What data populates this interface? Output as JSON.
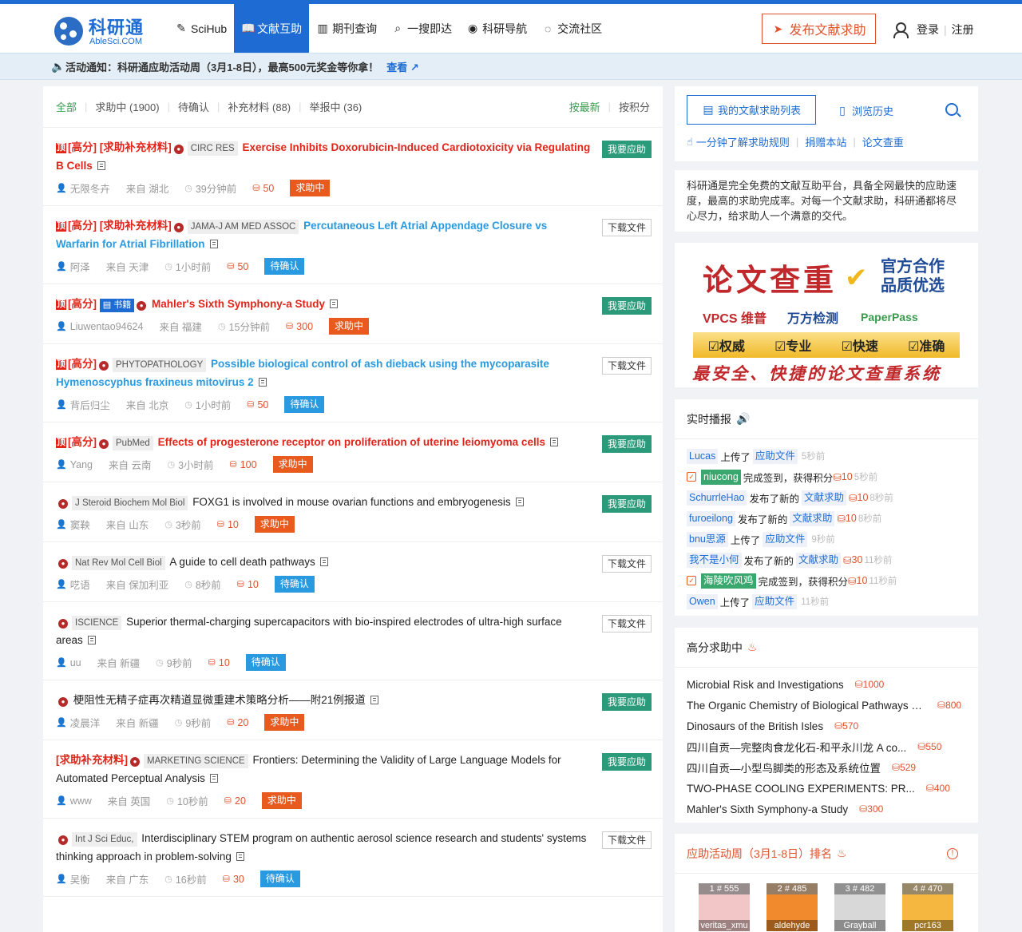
{
  "brand": {
    "name_cn": "科研通",
    "name_en": "AbleSci.COM"
  },
  "nav": [
    {
      "label": "SciHub",
      "icon": "feather-icon",
      "glyph": "✎"
    },
    {
      "label": "文献互助",
      "icon": "book-icon",
      "glyph": "📖",
      "active": true
    },
    {
      "label": "期刊查询",
      "icon": "journal-icon",
      "glyph": "▥"
    },
    {
      "label": "一搜即达",
      "icon": "search-icon",
      "glyph": "⌕"
    },
    {
      "label": "科研导航",
      "icon": "compass-icon",
      "glyph": "◉"
    },
    {
      "label": "交流社区",
      "icon": "chat-icon",
      "glyph": "◌"
    }
  ],
  "publish_label": "发布文献求助",
  "login_label": "登录",
  "register_label": "注册",
  "notice": {
    "text": "活动通知：科研通应助活动周（3月1-8日），最高500元奖金等你拿！",
    "link": "查看"
  },
  "filters": {
    "tabs": [
      "全部",
      "求助中 (1900)",
      "待确认",
      "补充材料 (88)",
      "举报中 (36)"
    ],
    "sort": [
      "按最新",
      "按积分"
    ]
  },
  "posts": [
    {
      "pin": true,
      "tags": "[高分] [求助补充材料]",
      "journal": "CIRC RES",
      "title": "Exercise Inhibits Doxorubicin-Induced Cardiotoxicity via Regulating B Cells",
      "title_color": "red",
      "user": "无限冬卉",
      "from": "来自 湖北",
      "time": "39分钟前",
      "points": "50",
      "status": "求助中",
      "action": "我要应助"
    },
    {
      "pin": true,
      "tags": "[高分] [求助补充材料]",
      "journal": "JAMA-J AM MED ASSOC",
      "title": "Percutaneous Left Atrial Appendage Closure vs Warfarin for Atrial Fibrillation",
      "title_color": "blue",
      "user": "阿泽",
      "from": "来自 天津",
      "time": "1小时前",
      "points": "50",
      "status": "待确认",
      "action": "下载文件"
    },
    {
      "pin": true,
      "tags": "[高分]",
      "book": "书籍",
      "journal": "",
      "title": "Mahler's Sixth Symphony-a Study",
      "title_color": "red",
      "user": "Liuwentao94624",
      "from": "来自 福建",
      "time": "15分钟前",
      "points": "300",
      "status": "求助中",
      "action": "我要应助"
    },
    {
      "pin": true,
      "tags": "[高分]",
      "journal": "PHYTOPATHOLOGY",
      "title": "Possible biological control of ash dieback using the mycoparasite Hymenoscyphus fraxineus mitovirus 2",
      "title_color": "blue",
      "user": "背后归尘",
      "from": "来自 北京",
      "time": "1小时前",
      "points": "50",
      "status": "待确认",
      "action": "下载文件"
    },
    {
      "pin": true,
      "tags": "[高分]",
      "journal": "PubMed",
      "title": "Effects of progesterone receptor on proliferation of uterine leiomyoma cells",
      "title_color": "red",
      "user": "Yang",
      "from": "来自 云南",
      "time": "3小时前",
      "points": "100",
      "status": "求助中",
      "action": "我要应助"
    },
    {
      "pin": false,
      "tags": "",
      "journal": "J Steroid Biochem Mol Biol",
      "title": "FOXG1 is involved in mouse ovarian functions and embryogenesis",
      "title_color": "black",
      "user": "窦鞅",
      "from": "来自 山东",
      "time": "3秒前",
      "points": "10",
      "status": "求助中",
      "action": "我要应助"
    },
    {
      "pin": false,
      "tags": "",
      "journal": "Nat Rev Mol Cell Biol",
      "title": "A guide to cell death pathways",
      "title_color": "black",
      "user": "呓语",
      "from": "来自 保加利亚",
      "time": "8秒前",
      "points": "10",
      "status": "待确认",
      "action": "下载文件"
    },
    {
      "pin": false,
      "tags": "",
      "journal": "ISCIENCE",
      "title": "Superior thermal-charging supercapacitors with bio-inspired electrodes of ultra-high surface areas",
      "title_color": "black",
      "user": "uu",
      "from": "来自 新疆",
      "time": "9秒前",
      "points": "10",
      "status": "待确认",
      "action": "下载文件"
    },
    {
      "pin": false,
      "tags": "",
      "journal": "",
      "title": "梗阻性无精子症再次精道显微重建术策略分析——附21例报道",
      "title_color": "black",
      "user": "凌晨洋",
      "from": "来自 新疆",
      "time": "9秒前",
      "points": "20",
      "status": "求助中",
      "action": "我要应助"
    },
    {
      "pin": false,
      "tags": "[求助补充材料]",
      "journal": "MARKETING SCIENCE",
      "title": "Frontiers: Determining the Validity of Large Language Models for Automated Perceptual Analysis",
      "title_color": "black",
      "user": "www",
      "from": "来自 英国",
      "time": "10秒前",
      "points": "20",
      "status": "求助中",
      "action": "我要应助"
    },
    {
      "pin": false,
      "tags": "",
      "journal": "Int J Sci Educ,",
      "title": "Interdisciplinary STEM program on authentic aerosol science research and students' systems thinking approach in problem-solving",
      "title_color": "black",
      "user": "吴衡",
      "from": "来自 广东",
      "time": "16秒前",
      "points": "30",
      "status": "待确认",
      "action": "下载文件"
    }
  ],
  "sidebar": {
    "my_list": "我的文献求助列表",
    "history": "浏览历史",
    "rules": "一分钟了解求助规则",
    "donate": "捐赠本站",
    "check": "论文查重",
    "intro": "科研通是完全免费的文献互助平台，具备全网最快的应助速度，最高的求助完成率。对每一个文献求助，科研通都将尽心尽力，给求助人一个满意的交代。"
  },
  "ad": {
    "title": "论文查重",
    "side": [
      "官方合作",
      "品质优选"
    ],
    "brands": [
      "VPCS 维普",
      "万方检测",
      "PaperPass"
    ],
    "features": [
      "☑权威",
      "☑专业",
      "☑快速",
      "☑准确"
    ],
    "slogan": "最安全、快捷的论文查重系统"
  },
  "live": {
    "title": "实时播报",
    "rows": [
      {
        "user": "Lucas",
        "action": "上传了",
        "pill": "应助文件",
        "pts": "",
        "ago": "5秒前"
      },
      {
        "check": true,
        "user": "niucong",
        "green": true,
        "action": "完成签到，获得积分",
        "pill": "",
        "pts": "10",
        "ago": "5秒前"
      },
      {
        "user": "SchurrleHao",
        "action": "发布了新的",
        "pill": "文献求助",
        "pts": "10",
        "ago": "8秒前"
      },
      {
        "user": "furoeilong",
        "action": "发布了新的",
        "pill": "文献求助",
        "pts": "10",
        "ago": "8秒前"
      },
      {
        "user": "bnu思源",
        "action": "上传了",
        "pill": "应助文件",
        "pts": "",
        "ago": "9秒前"
      },
      {
        "user": "我不是小何",
        "action": "发布了新的",
        "pill": "文献求助",
        "pts": "30",
        "ago": "11秒前"
      },
      {
        "check": true,
        "user": "海陵吹风鸡",
        "green": true,
        "action": "完成签到，获得积分",
        "pill": "",
        "pts": "10",
        "ago": "11秒前"
      },
      {
        "user": "Owen",
        "action": "上传了",
        "pill": "应助文件",
        "pts": "",
        "ago": "11秒前"
      }
    ]
  },
  "high_score": {
    "title": "高分求助中",
    "items": [
      {
        "text": "Microbial Risk and Investigations",
        "pts": "1000"
      },
      {
        "text": "The Organic Chemistry of Biological Pathways 2...",
        "pts": "800"
      },
      {
        "text": "Dinosaurs of the British Isles",
        "pts": "570"
      },
      {
        "text": "四川自贡—完整肉食龙化石-和平永川龙 A co...",
        "pts": "550"
      },
      {
        "text": "四川自贡—小型鸟脚类的形态及系统位置",
        "pts": "529"
      },
      {
        "text": "TWO-PHASE COOLING EXPERIMENTS: PR...",
        "pts": "400"
      },
      {
        "text": "Mahler's Sixth Symphony-a Study",
        "pts": "300"
      }
    ]
  },
  "rank": {
    "title": "应助活动周（3月1-8日）排名",
    "items": [
      {
        "badge": "1 # 555",
        "name": "veritas_xmu",
        "color": "#f2c6c6"
      },
      {
        "badge": "2 # 485",
        "name": "aldehyde",
        "color": "#f08a2c"
      },
      {
        "badge": "3 # 482",
        "name": "Grayball",
        "color": "#d8d8d8"
      },
      {
        "badge": "4 # 470",
        "name": "pcr163",
        "color": "#f5b740"
      }
    ]
  }
}
